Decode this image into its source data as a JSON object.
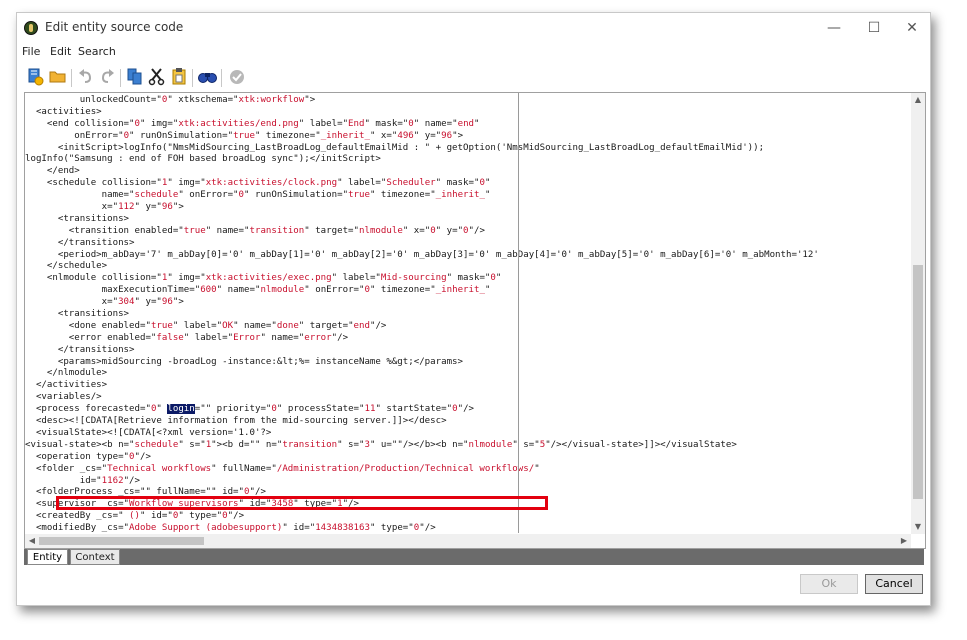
{
  "window": {
    "title": "Edit entity source code"
  },
  "menu": [
    "File",
    "Edit",
    "Search"
  ],
  "toolbar_icons": [
    "new-icon",
    "open-folder-icon",
    "undo-icon",
    "redo-icon",
    "copy-icon",
    "cut-icon",
    "paste-icon",
    "find-icon",
    "validate-icon"
  ],
  "code_lines": [
    "          unlockedCount=\"0\" xtkschema=\"xtk:workflow\">",
    "  <activities>",
    "    <end collision=\"0\" img=\"xtk:activities/end.png\" label=\"End\" mask=\"0\" name=\"end\"",
    "         onError=\"0\" runOnSimulation=\"true\" timezone=\"_inherit_\" x=\"496\" y=\"96\">",
    "      <initScript>logInfo(\"NmsMidSourcing_LastBroadLog_defaultEmailMid : \" + getOption('NmsMidSourcing_LastBroadLog_defaultEmailMid'));",
    "logInfo(\"Samsung : end of FOH based broadLog sync\");</initScript>",
    "    </end>",
    "    <schedule collision=\"1\" img=\"xtk:activities/clock.png\" label=\"Scheduler\" mask=\"0\"",
    "              name=\"schedule\" onError=\"0\" runOnSimulation=\"true\" timezone=\"_inherit_\"",
    "              x=\"112\" y=\"96\">",
    "      <transitions>",
    "        <transition enabled=\"true\" name=\"transition\" target=\"nlmodule\" x=\"0\" y=\"0\"/>",
    "      </transitions>",
    "      <period>m_abDay='7' m_abDay[0]='0' m_abDay[1]='0' m_abDay[2]='0' m_abDay[3]='0' m_abDay[4]='0' m_abDay[5]='0' m_abDay[6]='0' m_abMonth='12'",
    "    </schedule>",
    "    <nlmodule collision=\"1\" img=\"xtk:activities/exec.png\" label=\"Mid-sourcing\" mask=\"0\"",
    "              maxExecutionTime=\"600\" name=\"nlmodule\" onError=\"0\" timezone=\"_inherit_\"",
    "              x=\"304\" y=\"96\">",
    "      <transitions>",
    "        <done enabled=\"true\" label=\"OK\" name=\"done\" target=\"end\"/>",
    "        <error enabled=\"false\" label=\"Error\" name=\"error\"/>",
    "      </transitions>",
    "      <params>midSourcing -broadLog -instance:&lt;%= instanceName %&gt;</params>",
    "    </nlmodule>",
    "  </activities>",
    "  <variables/>",
    "  <process forecasted=\"0\" login=\"\" priority=\"0\" processState=\"11\" startState=\"0\"/>",
    "  <desc><![CDATA[Retrieve information from the mid-sourcing server.]]></desc>",
    "  <visualState><![CDATA[<?xml version='1.0'?>",
    "<visual-state><b n=\"schedule\" s=\"1\"><b d=\"\" n=\"transition\" s=\"3\" u=\"\"/></b><b n=\"nlmodule\" s=\"5\"/></visual-state>]]></visualState>",
    "  <operation type=\"0\"/>",
    "  <folder _cs=\"Technical workflows\" fullName=\"/Administration/Production/Technical workflows/\"",
    "          id=\"1162\"/>",
    "  <folderProcess _cs=\"\" fullName=\"\" id=\"0\"/>",
    "  <supervisor _cs=\"Workflow supervisors\" id=\"3458\" type=\"1\"/>",
    "  <createdBy _cs=\" ()\" id=\"0\" type=\"0\"/>",
    "  <modifiedBy _cs=\"Adobe Support (adobesupport)\" id=\"1434838163\" type=\"0\"/>"
  ],
  "tabs": [
    "Entity",
    "Context"
  ],
  "buttons": {
    "ok": "Ok",
    "cancel": "Cancel"
  }
}
